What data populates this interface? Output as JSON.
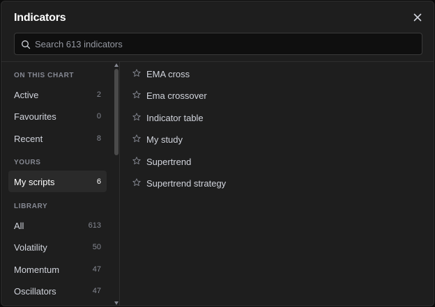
{
  "dialog": {
    "title": "Indicators",
    "close_icon": "close-icon"
  },
  "search": {
    "placeholder": "Search 613 indicators",
    "value": ""
  },
  "sidebar": {
    "sections": [
      {
        "label": "ON THIS CHART",
        "items": [
          {
            "label": "Active",
            "count": "2"
          },
          {
            "label": "Favourites",
            "count": "0"
          },
          {
            "label": "Recent",
            "count": "8"
          }
        ]
      },
      {
        "label": "YOURS",
        "items": [
          {
            "label": "My scripts",
            "count": "6",
            "selected": true
          }
        ]
      },
      {
        "label": "LIBRARY",
        "items": [
          {
            "label": "All",
            "count": "613"
          },
          {
            "label": "Volatility",
            "count": "50"
          },
          {
            "label": "Momentum",
            "count": "47"
          },
          {
            "label": "Oscillators",
            "count": "47"
          }
        ]
      }
    ]
  },
  "scripts": {
    "items": [
      {
        "name": "EMA cross",
        "icon": "star-icon"
      },
      {
        "name": "Ema crossover",
        "icon": "star-icon"
      },
      {
        "name": "Indicator table",
        "icon": "star-icon"
      },
      {
        "name": "My study",
        "icon": "star-icon"
      },
      {
        "name": "Supertrend",
        "icon": "star-icon"
      },
      {
        "name": "Supertrend strategy",
        "icon": "star-icon"
      }
    ]
  },
  "colors": {
    "background": "#1e1e1e",
    "selected_item": "#2a2a2a",
    "text": "#d1d4dc",
    "muted": "#868993"
  }
}
